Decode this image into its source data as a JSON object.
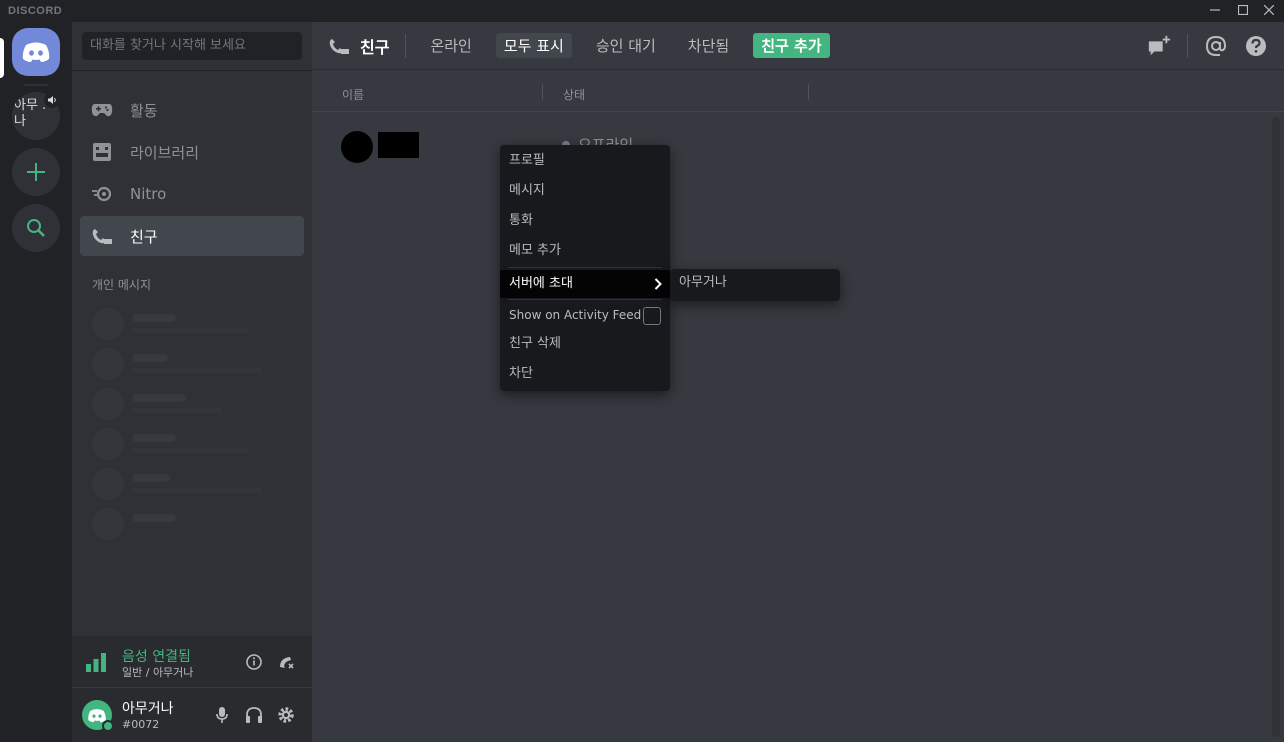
{
  "window": {
    "brand": "DISCORD",
    "minimize_icon": "minus",
    "maximize_icon": "square",
    "close_icon": "x"
  },
  "rail": {
    "home_icon": "discord-logo",
    "server_label": "아무거나",
    "server_chars": [
      "아무 .",
      "나"
    ],
    "add_icon": "plus",
    "explore_icon": "magnifier"
  },
  "sidebar": {
    "search_placeholder": "대화를 찾거나 시작해 보세요",
    "items": [
      {
        "label": "활동",
        "icon": "gamepad-icon"
      },
      {
        "label": "라이브러리",
        "icon": "library-icon"
      },
      {
        "label": "Nitro",
        "icon": "nitro-icon"
      },
      {
        "label": "친구",
        "icon": "friends-icon",
        "active": true
      }
    ],
    "dm_header": "개인 메시지"
  },
  "voice": {
    "status": "음성 연결됨",
    "channel": "일반 / 아무거나"
  },
  "user": {
    "name": "아무거나",
    "tag": "#0072"
  },
  "header": {
    "title": "친구",
    "tabs": [
      {
        "label": "온라인"
      },
      {
        "label": "모두 표시",
        "selected": true
      },
      {
        "label": "승인 대기"
      },
      {
        "label": "차단됨"
      },
      {
        "label": "친구 추가",
        "accent": true
      }
    ]
  },
  "columns": {
    "name": "이름",
    "status": "상태"
  },
  "friend": {
    "status": "오프라인"
  },
  "context_menu": {
    "items": [
      "프로필",
      "메시지",
      "통화",
      "메모 추가"
    ],
    "invite": "서버에 초대",
    "activity_feed": "Show on Activity Feed",
    "remove": "친구 삭제",
    "block": "차단"
  },
  "submenu": {
    "item": "아무거나"
  },
  "colors": {
    "blurple": "#7289da",
    "green": "#43b581",
    "bg_main": "#36393f",
    "bg_sidebar": "#2f3136",
    "bg_rail": "#202225"
  }
}
